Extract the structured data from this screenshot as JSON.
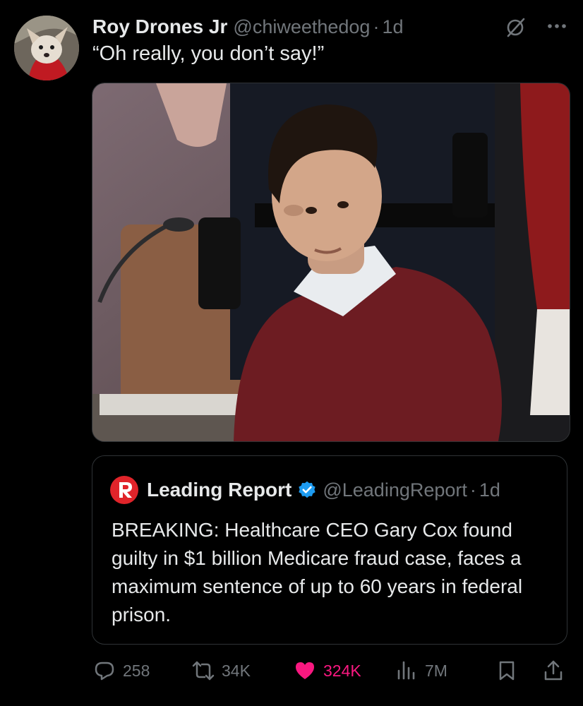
{
  "tweet": {
    "display_name": "Roy Drones Jr",
    "handle": "@chiweethedog",
    "separator": "·",
    "time": "1d",
    "text": "“Oh really, you don’t say!”"
  },
  "quote": {
    "display_name": "Leading Report",
    "handle": "@LeadingReport",
    "separator": "·",
    "time": "1d",
    "text": "BREAKING: Healthcare CEO Gary Cox found guilty in $1 billion Medicare fraud case, faces a maximum sentence of up to 60 years in federal prison."
  },
  "actions": {
    "replies": "258",
    "reposts": "34K",
    "likes": "324K",
    "views": "7M"
  },
  "icons": {
    "more": "more-icon",
    "grok": "grok-icon",
    "reply": "reply-icon",
    "repost": "repost-icon",
    "like": "heart-icon",
    "views": "views-icon",
    "bookmark": "bookmark-icon",
    "share": "share-icon"
  },
  "colors": {
    "background": "#000000",
    "text": "#e7e9ea",
    "muted": "#71767b",
    "like": "#f91880",
    "verified": "#1d9bf0",
    "brand_red": "#e0242a"
  }
}
